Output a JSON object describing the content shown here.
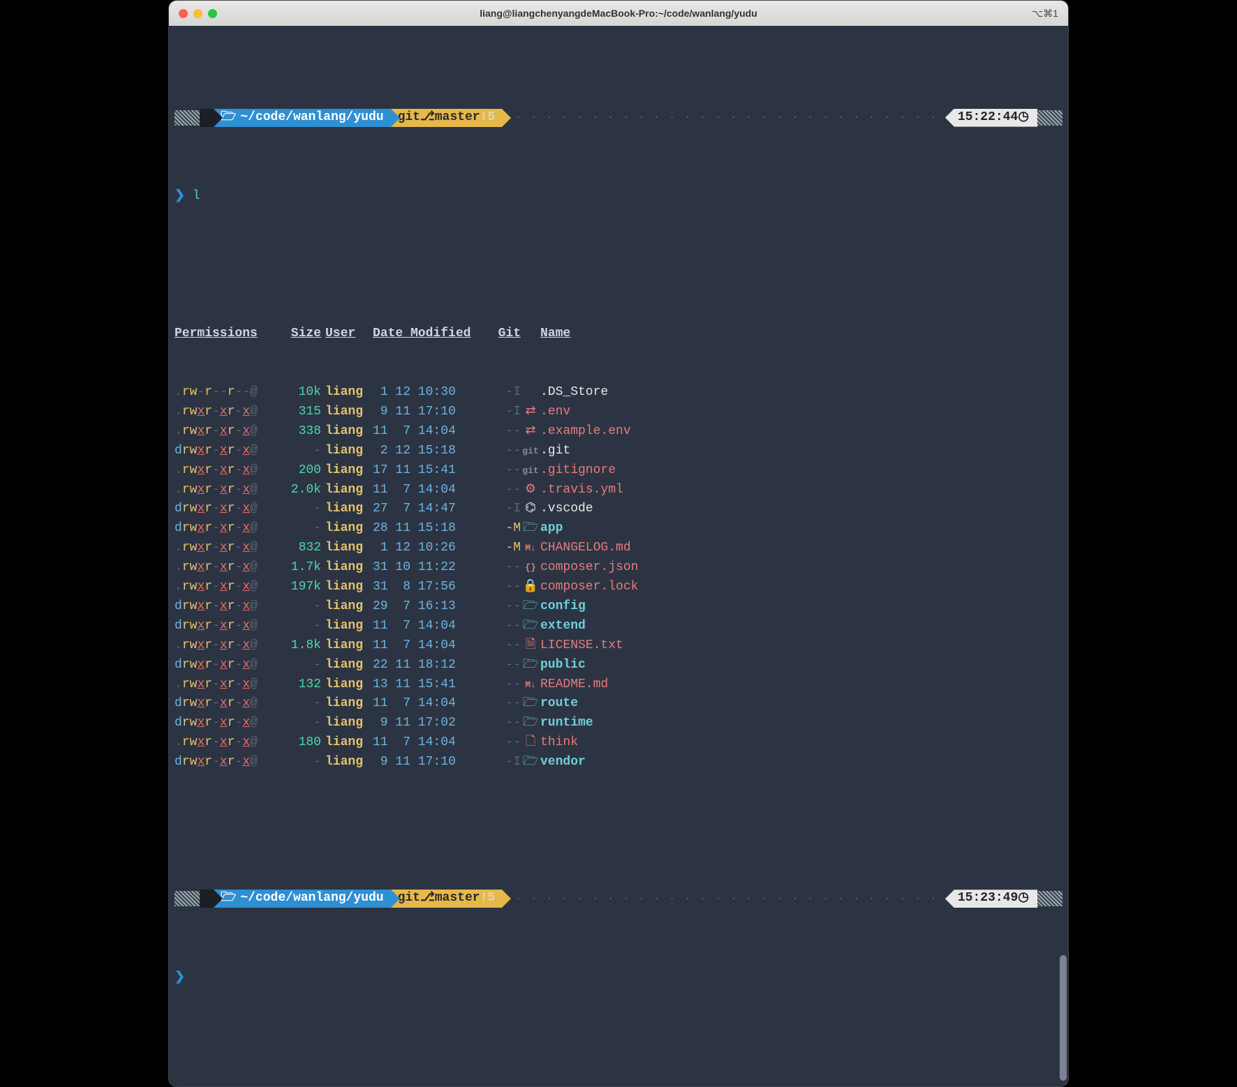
{
  "window": {
    "title": "liang@liangchenyangdeMacBook-Pro:~/code/wanlang/yudu",
    "shortcut": "⌥⌘1"
  },
  "prompt1": {
    "path_prefix": "~/code/wanlang/",
    "path_tail": "yudu",
    "git_label": "git",
    "branch": "master",
    "dirty": "!5",
    "time": "15:22:44"
  },
  "command1": "l",
  "headers": {
    "permissions": "Permissions",
    "size": "Size",
    "user": "User",
    "date": "Date Modified",
    "git": "Git",
    "name": "Name"
  },
  "rows": [
    {
      "perm": ".rw-r--r--@",
      "size": "10k",
      "user": "liang",
      "date": " 1 12 10:30",
      "git": "-I",
      "icon": "",
      "iconClass": "c-iconW",
      "name": ".DS_Store",
      "nameClass": "c-nameW"
    },
    {
      "perm": ".rwxr-xr-x@",
      "size": "315",
      "user": "liang",
      "date": " 9 11 17:10",
      "git": "-I",
      "icon": "⇄",
      "iconClass": "c-iconR",
      "name": ".env",
      "nameClass": "c-nameR"
    },
    {
      "perm": ".rwxr-xr-x@",
      "size": "338",
      "user": "liang",
      "date": "11  7 14:04",
      "git": "--",
      "icon": "⇄",
      "iconClass": "c-iconR",
      "name": ".example.env",
      "nameClass": "c-nameR"
    },
    {
      "perm": "drwxr-xr-x@",
      "size": "-",
      "user": "liang",
      "date": " 2 12 15:18",
      "git": "--",
      "icon": "git",
      "iconClass": "c-iconG",
      "name": ".git",
      "nameClass": "c-nameW"
    },
    {
      "perm": ".rwxr-xr-x@",
      "size": "200",
      "user": "liang",
      "date": "17 11 15:41",
      "git": "--",
      "icon": "git",
      "iconClass": "c-iconG",
      "name": ".gitignore",
      "nameClass": "c-nameR"
    },
    {
      "perm": ".rwxr-xr-x@",
      "size": "2.0k",
      "user": "liang",
      "date": "11  7 14:04",
      "git": "--",
      "icon": "⚙",
      "iconClass": "c-iconR",
      "name": ".travis.yml",
      "nameClass": "c-nameR"
    },
    {
      "perm": "drwxr-xr-x@",
      "size": "-",
      "user": "liang",
      "date": "27  7 14:47",
      "git": "-I",
      "icon": "⌬",
      "iconClass": "c-iconW",
      "name": ".vscode",
      "nameClass": "c-nameW"
    },
    {
      "perm": "drwxr-xr-x@",
      "size": "-",
      "user": "liang",
      "date": "28 11 15:18",
      "git": "-M",
      "icon": "🗁",
      "iconClass": "c-iconT",
      "name": "app",
      "nameClass": "c-nameT"
    },
    {
      "perm": ".rwxr-xr-x@",
      "size": "832",
      "user": "liang",
      "date": " 1 12 10:26",
      "git": "-M",
      "icon": "M↓",
      "iconClass": "c-iconR",
      "name": "CHANGELOG.md",
      "nameClass": "c-nameR"
    },
    {
      "perm": ".rwxr-xr-x@",
      "size": "1.7k",
      "user": "liang",
      "date": "31 10 11:22",
      "git": "--",
      "icon": "{}",
      "iconClass": "c-iconR",
      "name": "composer.json",
      "nameClass": "c-nameR"
    },
    {
      "perm": ".rwxr-xr-x@",
      "size": "197k",
      "user": "liang",
      "date": "31  8 17:56",
      "git": "--",
      "icon": "🔒",
      "iconClass": "c-iconR",
      "name": "composer.lock",
      "nameClass": "c-nameR"
    },
    {
      "perm": "drwxr-xr-x@",
      "size": "-",
      "user": "liang",
      "date": "29  7 16:13",
      "git": "--",
      "icon": "🗁",
      "iconClass": "c-iconT",
      "name": "config",
      "nameClass": "c-nameT"
    },
    {
      "perm": "drwxr-xr-x@",
      "size": "-",
      "user": "liang",
      "date": "11  7 14:04",
      "git": "--",
      "icon": "🗁",
      "iconClass": "c-iconT",
      "name": "extend",
      "nameClass": "c-nameT"
    },
    {
      "perm": ".rwxr-xr-x@",
      "size": "1.8k",
      "user": "liang",
      "date": "11  7 14:04",
      "git": "--",
      "icon": "🗎",
      "iconClass": "c-iconR",
      "name": "LICENSE.txt",
      "nameClass": "c-nameR"
    },
    {
      "perm": "drwxr-xr-x@",
      "size": "-",
      "user": "liang",
      "date": "22 11 18:12",
      "git": "--",
      "icon": "🗁",
      "iconClass": "c-iconT",
      "name": "public",
      "nameClass": "c-nameT"
    },
    {
      "perm": ".rwxr-xr-x@",
      "size": "132",
      "user": "liang",
      "date": "13 11 15:41",
      "git": "--",
      "icon": "M↓",
      "iconClass": "c-iconR",
      "name": "README.md",
      "nameClass": "c-nameR"
    },
    {
      "perm": "drwxr-xr-x@",
      "size": "-",
      "user": "liang",
      "date": "11  7 14:04",
      "git": "--",
      "icon": "🗁",
      "iconClass": "c-iconT",
      "name": "route",
      "nameClass": "c-nameT"
    },
    {
      "perm": "drwxr-xr-x@",
      "size": "-",
      "user": "liang",
      "date": " 9 11 17:02",
      "git": "--",
      "icon": "🗁",
      "iconClass": "c-iconT",
      "name": "runtime",
      "nameClass": "c-nameT"
    },
    {
      "perm": ".rwxr-xr-x@",
      "size": "180",
      "user": "liang",
      "date": "11  7 14:04",
      "git": "--",
      "icon": "🗋",
      "iconClass": "c-iconR",
      "name": "think",
      "nameClass": "c-nameR"
    },
    {
      "perm": "drwxr-xr-x@",
      "size": "-",
      "user": "liang",
      "date": " 9 11 17:10",
      "git": "-I",
      "icon": "🗁",
      "iconClass": "c-iconT",
      "name": "vendor",
      "nameClass": "c-nameT"
    }
  ],
  "prompt2": {
    "path_prefix": "~/code/wanlang/",
    "path_tail": "yudu",
    "git_label": "git",
    "branch": "master",
    "dirty": "!5",
    "time": "15:23:49"
  },
  "dots": "· · · · · · · · · · · · · · · · · · · · · · · · · · · · · · · · · · · · · · · · · · · · · · · · · · · · · · · · · · · · · · · · · · · · · · · · · · · · · · · · · · · · ·"
}
